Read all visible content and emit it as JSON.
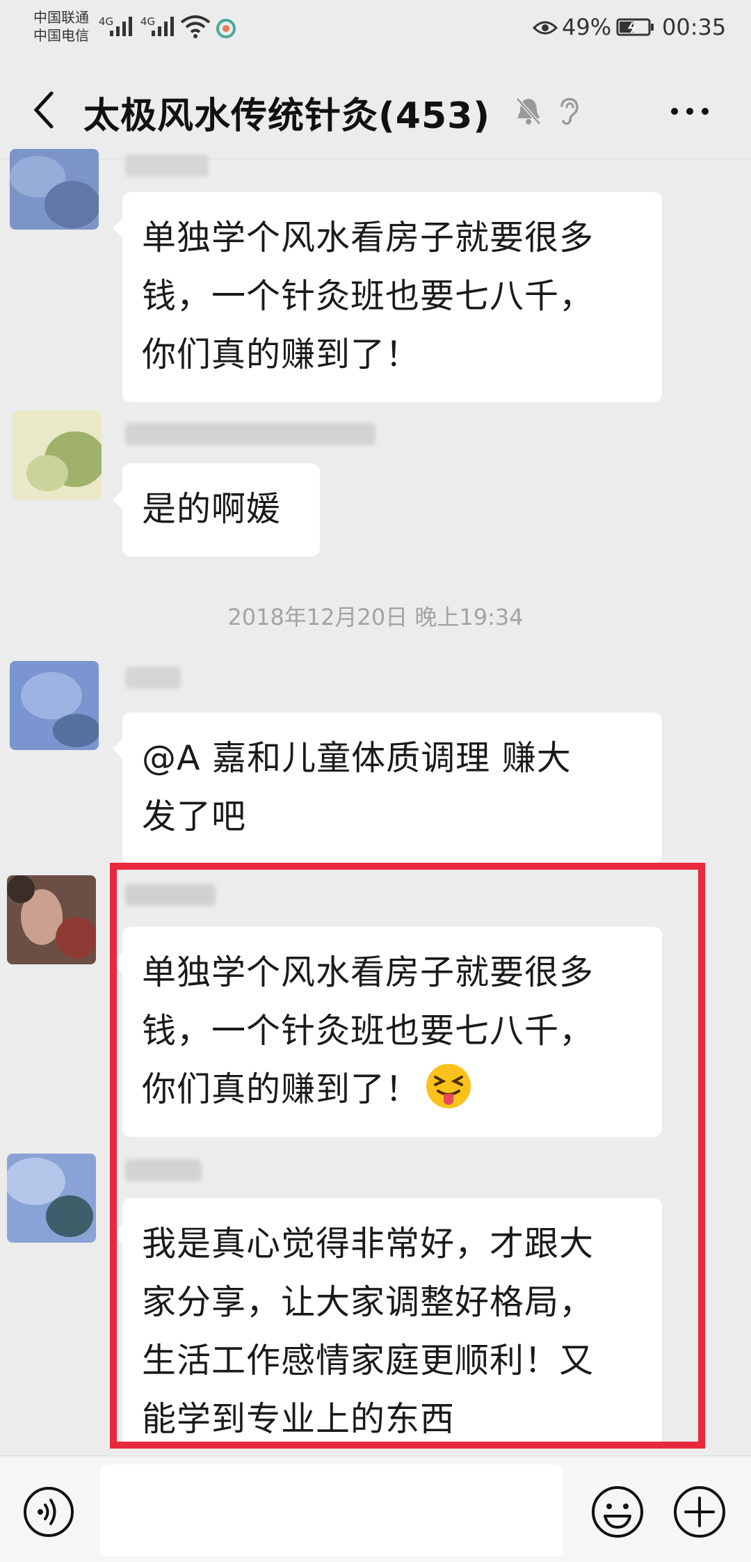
{
  "status_bar": {
    "carrier_1": "中国联通",
    "carrier_2": "中国电信",
    "network_1": "4G",
    "network_2": "4G",
    "battery_percent": "49%",
    "time": "00:35"
  },
  "header": {
    "title": "太极风水传统针灸(453)"
  },
  "chat": {
    "timestamp": "2018年12月20日 晚上19:34",
    "messages": [
      {
        "lines": [
          "单独学个风水看房子就要很多",
          "钱，一个针灸班也要七八千，",
          "你们真的赚到了！"
        ]
      },
      {
        "lines": [
          "是的啊媛"
        ]
      },
      {
        "lines": [
          "@A 嘉和儿童体质调理  赚大",
          "发了吧"
        ]
      },
      {
        "lines": [
          "单独学个风水看房子就要很多",
          "钱，一个针灸班也要七八千，",
          "你们真的赚到了！"
        ],
        "emoji": "squinting-tongue-emoji"
      },
      {
        "lines": [
          "我是真心觉得非常好，才跟大",
          "家分享，让大家调整好格局，",
          "生活工作感情家庭更顺利！又",
          "能学到专业上的东西"
        ]
      }
    ]
  },
  "icons": {
    "back": "back-arrow-icon",
    "mute": "mute-bell-icon",
    "ear": "ear-icon",
    "more": "more-icon",
    "voice": "voice-icon",
    "emoji": "emoji-icon",
    "plus": "plus-icon"
  },
  "colors": {
    "background": "#ececec",
    "bubble": "#ffffff",
    "highlight": "#e8283d",
    "timestamp": "#a3a3a3"
  }
}
